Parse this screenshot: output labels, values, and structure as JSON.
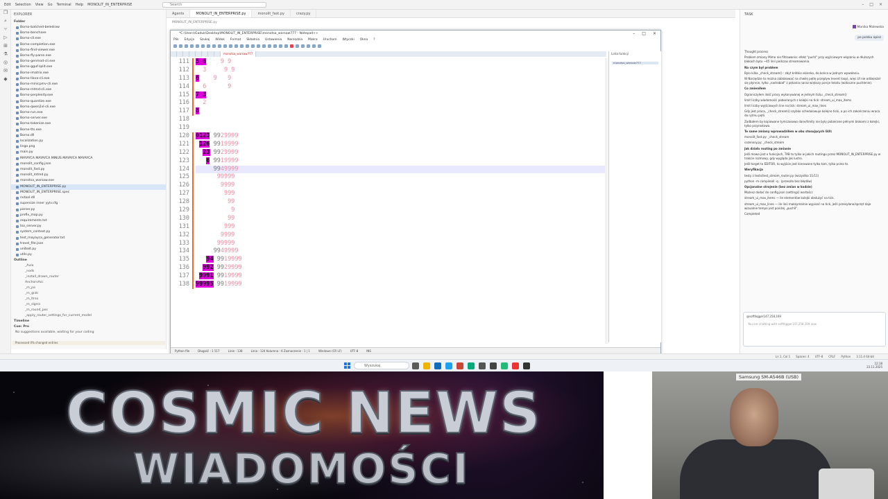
{
  "titlebar": {
    "menu": [
      "Edit",
      "Selection",
      "View",
      "Go",
      "Terminal",
      "Help",
      "MONOLIT_IN_ENTERPRISE"
    ],
    "search_placeholder": "Search"
  },
  "explorer": {
    "title": "Explorer",
    "folder": "Folder",
    "files": [
      "Borno-batched-beledraw",
      "Borno-benchaxe",
      "Borno-cli.exe",
      "Borno-completion.exe",
      "Borno-find-viewer.exe",
      "Borno-fly-parse.exe",
      "Borno-genmod-cli.exe",
      "Borno-gguf-split.exe",
      "Borno-imatrix.exe",
      "Borno-llava-cli.exe",
      "Borno-minicpmv-cli.exe",
      "Borno-mtmd-cli.exe",
      "Borno-perplexity.exe",
      "Borno-quantize.exe",
      "Borno-qwen2vl-cli.exe",
      "Borno-run.exe",
      "Borno-server.exe",
      "Borno-tokenize.exe",
      "Borno-tts.exe",
      "Borno.dll",
      "localization.py",
      "lingo.png",
      "main.py",
      "MAYAYCA MAYAYCA MINUS MAYAYCA MAYAYCA",
      "monolit_config.json",
      "monolit_fast.py",
      "monolit_mtmd.py",
      "monotsa_warsaw.exe",
      "MONOLIT_IN_ENTERPRISE.py",
      "MONOLIT_IN_ENTERPRISE.spec",
      "nvtool.dll",
      "supersize inner yylv.cfg",
      "parser.py",
      "prefix_map.py",
      "requirements.txt",
      "tso_server.py",
      "system_context.py",
      "test_mayayca_generator.txt",
      "travel_file.json",
      "unibait.py",
      "utils.py"
    ],
    "selected_index": 28,
    "outline_label": "Outline",
    "outline_items": [
      "_Aula",
      "_nods",
      "_install_drawn_router",
      "AnchorsAcc",
      "_m_pa",
      "_m_grzk",
      "_m_ltrso",
      "_m_slgrcs",
      "_m_round_pos",
      "_apply_router_settings_for_current_model"
    ],
    "timeline_label": "Timeline",
    "cue_label": "Cue: Pro",
    "cue_text": "No suggestions available, waiting for your coding",
    "status": "Processed 0% changed entries"
  },
  "editor_tabs": [
    "Agents",
    "MONOLIT_IN_ENTERPRISE.py",
    "monolit_fast.py",
    "crazy.py"
  ],
  "breadcrumb": "MONOLIT_IN_ENTERPRISE.py",
  "notepad": {
    "title": "*C:\\Users\\Gaduk\\Desktop\\MONOLIT_IN_ENTERPRISE\\monotsa_warsaw777 - Notepad++",
    "menu": [
      "Plik",
      "Edycja",
      "Szukaj",
      "Widok",
      "Format",
      "Składnia",
      "Ustawienia",
      "Narzędzia",
      "Makra",
      "Uruchom",
      "Wtyczki",
      "Okna",
      "?"
    ],
    "active_tab": "monotsa_warsaw777",
    "side_panel_label": "Lista funkcji",
    "side_panel_item": "monotsa_warsaw777",
    "lines": [
      {
        "n": "111",
        "pre": "",
        "mg": "5 6",
        "mid": "",
        "pk": "    9 9"
      },
      {
        "n": "112",
        "pre": "",
        "mg": "",
        "mid": "  ",
        "pk": "3     9 9"
      },
      {
        "n": "113",
        "pre": "",
        "mg": "6",
        "mid": "",
        "pk": "    9   9"
      },
      {
        "n": "114",
        "pre": "",
        "mg": "",
        "mid": "  ",
        "pk": "6      9"
      },
      {
        "n": "115",
        "pre": "",
        "mg": "7 3",
        "mid": "",
        "pk": ""
      },
      {
        "n": "116",
        "pre": "",
        "mg": "",
        "mid": "  ",
        "pk": "2"
      },
      {
        "n": "117",
        "pre": "",
        "mg": "8",
        "mid": "",
        "pk": ""
      },
      {
        "n": "118",
        "pre": "",
        "mg": "",
        "mid": "",
        "pk": ""
      },
      {
        "n": "119",
        "pre": "",
        "mg": "",
        "mid": "",
        "pk": ""
      },
      {
        "n": "120",
        "pre": "",
        "mg": "0123",
        "mid": " 99",
        "pk": "29999"
      },
      {
        "n": "121",
        "pre": " ",
        "mg": "126",
        "mid": " 99",
        "pk": "19999"
      },
      {
        "n": "122",
        "pre": "  ",
        "mg": "23",
        "mid": " 99",
        "pk": "29999"
      },
      {
        "n": "123",
        "pre": "   ",
        "mg": "6",
        "mid": " 99",
        "pk": "19999"
      },
      {
        "n": "124",
        "pre": "     ",
        "mg": "",
        "mid": "99",
        "pk": "49999"
      },
      {
        "n": "125",
        "pre": "      ",
        "mg": "",
        "mid": "",
        "pk": "99999"
      },
      {
        "n": "126",
        "pre": "       ",
        "mg": "",
        "mid": "",
        "pk": "9999"
      },
      {
        "n": "127",
        "pre": "        ",
        "mg": "",
        "mid": "",
        "pk": "999"
      },
      {
        "n": "128",
        "pre": "         ",
        "mg": "",
        "mid": "",
        "pk": "99"
      },
      {
        "n": "129",
        "pre": "          ",
        "mg": "",
        "mid": "",
        "pk": "9"
      },
      {
        "n": "130",
        "pre": "         ",
        "mg": "",
        "mid": "",
        "pk": "99"
      },
      {
        "n": "131",
        "pre": "        ",
        "mg": "",
        "mid": "",
        "pk": "999"
      },
      {
        "n": "132",
        "pre": "       ",
        "mg": "",
        "mid": "",
        "pk": "9999"
      },
      {
        "n": "133",
        "pre": "      ",
        "mg": "",
        "mid": "",
        "pk": "99999"
      },
      {
        "n": "134",
        "pre": "     ",
        "mg": "",
        "mid": "99",
        "pk": "49999"
      },
      {
        "n": "135",
        "pre": "   ",
        "mg": "94",
        "mid": " 99",
        "pk": "19999"
      },
      {
        "n": "136",
        "pre": "  ",
        "mg": "992",
        "mid": " 99",
        "pk": "29999"
      },
      {
        "n": "137",
        "pre": " ",
        "mg": "9991",
        "mid": " 99",
        "pk": "19999"
      },
      {
        "n": "138",
        "pre": "",
        "mg": "99995",
        "mid": " 99",
        "pk": "19999"
      }
    ],
    "current_line": 13,
    "status": [
      "Python file",
      "Długość : 1 517",
      "Linie : 138",
      "Linia : 124  Kolumna : 6  Zaznaczenie : 1 | 1",
      "Windows (CR LF)",
      "UTF-8",
      "INS"
    ]
  },
  "chat": {
    "header": "TASK",
    "user": "Monika Malewska",
    "bubble": "po polsku opisz",
    "paragraphs": [
      {
        "h": false,
        "t": "Thought process"
      },
      {
        "h": false,
        "t": "Problem zmiany Mimo nie filtrowania: efekt \"puchl\" przy wyjściowym wiązaniu w dłuższych blokach bytu ~45 linii podczas streamowania."
      },
      {
        "h": true,
        "t": "Na czym był problem"
      },
      {
        "h": false,
        "t": "Bylo kilka _check_stream() : zbyt krótkie okienko, do końca w jednym wywołaniu."
      },
      {
        "h": false,
        "t": "W Narzędzie to można zablokować na chwilę pętlę przepływ (event loop), więc UI nie odświeżał się płynnie, tylko „nadrabiał\" z pękania naraz większy porcje tekstu (widoczne puchlenie)."
      },
      {
        "h": true,
        "t": "Co zmieniłem"
      },
      {
        "h": false,
        "t": "Ograniczyłem ilość pracy wykonywanej w jednym ticku _check_stream()"
      },
      {
        "h": false,
        "t": "limit liczby wiadomości pobieranych z kolejki na tick: stream_ui_max_items"
      },
      {
        "h": false,
        "t": "limit liczby wyjściowych line na tick: stream_ui_max_lines"
      },
      {
        "h": false,
        "t": "Gdy jest praca, _check_stream() szybko schedulowuje kolejne ticki, a po ich zakończeniu wraca do rytmu pętli."
      },
      {
        "h": false,
        "t": "Zadbałem by kopiowane tymczasowo dane/limity nie były pobierane pełnymi blokami z kolejki, tylko przyrostowo."
      },
      {
        "h": true,
        "t": "Te same zmiany wprowadziłem w obu stosujących GUI:"
      },
      {
        "h": false,
        "t": "monolit_fast.py: _check_stream"
      },
      {
        "h": false,
        "t": "cozenary.py: _check_stream"
      },
      {
        "h": true,
        "t": "Jak działa routing po zmianie"
      },
      {
        "h": false,
        "t": "Jeśli mowa jest o funkcjach, TAB to tylko w jakich routingu przez MONOLIT_IN_ENTERPRISE.py w trakcie rozmowy, gdy wygląda jak lustro."
      },
      {
        "h": false,
        "t": "Jeśli target to EDITOR, to wyjście jest kierowane tylko tam, tylko przez to."
      },
      {
        "h": true,
        "t": "Weryfikacja"
      },
      {
        "h": false,
        "t": "testy z tests/test_stream_router.py (wszystko 11/11)"
      },
      {
        "h": false,
        "t": "python -m compileall -q . (przeszło bez błędów)"
      },
      {
        "h": true,
        "t": "Opcjonalne strojenie (bez zmian w kodzie)"
      },
      {
        "h": false,
        "t": "Możesz dodać do config.json (settings) wartości:"
      },
      {
        "h": false,
        "t": "stream_ui_max_items — ile elementów kolejki obsłużyć na tick."
      },
      {
        "h": false,
        "t": "stream_ui_max_lines — ile linii maksymalnie wypisać na tick, jeśli przesyłane/sprzęt daje wizualnie tempo jest poniżej „puchlI\"."
      },
      {
        "h": false,
        "t": "Completed"
      }
    ],
    "input_chip": "@softfogger147,258,169",
    "input_placeholder": "You are chatting with softfogger147,258,169 now"
  },
  "vscode_status": [
    "Ln 1, Col 1",
    "Spaces: 4",
    "UTF-8",
    "CRLF",
    "Python",
    "3.11.4 64-bit"
  ],
  "taskbar": {
    "search_placeholder": "Wyszukaj",
    "time": "12:18",
    "date": "23.11.2025",
    "icon_colors": [
      "#5b5b5b",
      "#f0b400",
      "#0f6cbd",
      "#1da1f2",
      "#c43",
      "#0a7",
      "#555",
      "#444",
      "#2b7",
      "#e33",
      "#333"
    ]
  },
  "banner": {
    "line1": "COSMIC NEWS",
    "line2": "WIADOMOŚCI"
  },
  "webcam": {
    "label": "Samsung SM-A546B (USB)"
  }
}
